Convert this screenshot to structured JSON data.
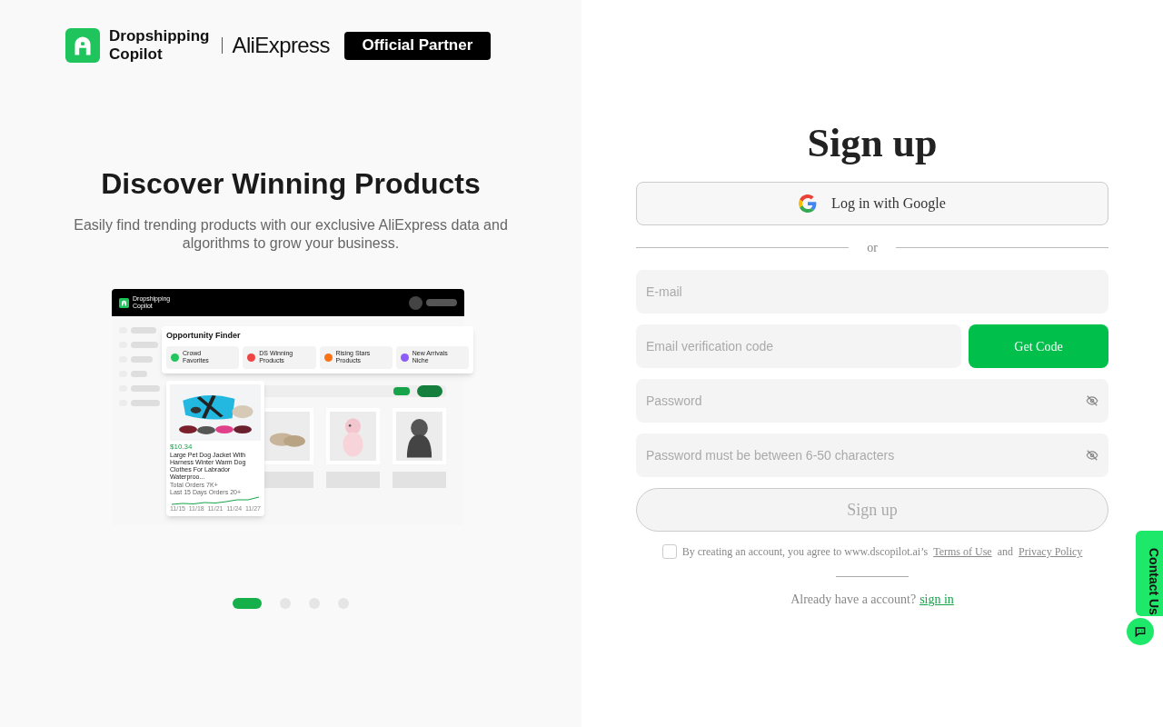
{
  "brand": {
    "name_line1": "Dropshipping",
    "name_line2": "Copilot",
    "partner": "AliExpress",
    "badge": "Official Partner"
  },
  "hero": {
    "title": "Discover Winning Products",
    "subtitle": "Easily find trending products with our exclusive AliExpress data and algorithms to grow your business."
  },
  "preview": {
    "app_name_line1": "Dropshipping",
    "app_name_line2": "Copilot",
    "panel_title": "Opportunity Finder",
    "categories": [
      {
        "label_line1": "Crowd",
        "label_line2": "Favorites",
        "color": "#22c55e"
      },
      {
        "label_line1": "DS Winning",
        "label_line2": "Products",
        "color": "#ef4444"
      },
      {
        "label_line1": "Rising Stars",
        "label_line2": "Products",
        "color": "#f97316"
      },
      {
        "label_line1": "New Arrivals",
        "label_line2": "Niche",
        "color": "#8b5cf6"
      }
    ],
    "product": {
      "price": "$10.34",
      "title": "Large Pet Dog Jacket With Harness Winter Warm Dog Clothes For Labrador Waterproo...",
      "total_orders": "Total Orders 7K+",
      "recent_orders": "Last 15 Days Orders 20+",
      "dates": [
        "11/15",
        "11/18",
        "11/21",
        "11/24",
        "11/27"
      ]
    }
  },
  "carousel": [
    {
      "selected": true
    },
    {
      "selected": false
    },
    {
      "selected": false
    },
    {
      "selected": false
    }
  ],
  "form": {
    "title": "Sign up",
    "google_button": "Log in with Google",
    "divider": "or",
    "email": {
      "placeholder": "E-mail"
    },
    "code": {
      "placeholder": "Email verification code"
    },
    "get_code": "Get Code",
    "password": {
      "placeholder": "Password"
    },
    "confirm": {
      "placeholder": "Password must be between 6-50 characters"
    },
    "submit": {
      "label": "Sign up",
      "disabled": true
    },
    "agree": {
      "checked": false,
      "text": "By creating an account, you agree to www.dscopilot.ai’s",
      "terms": "Terms of Use",
      "and": "and",
      "privacy": "Privacy Policy"
    },
    "signin_prompt": "Already have a account?",
    "signin_link": "sign in"
  },
  "contact": "Contact Us"
}
